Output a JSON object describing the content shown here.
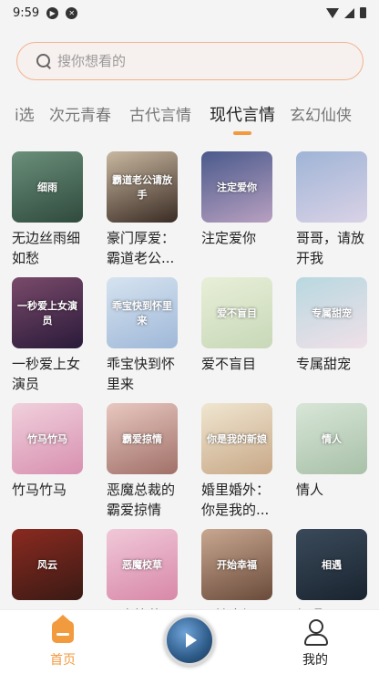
{
  "status": {
    "time": "9:59"
  },
  "search": {
    "placeholder": "搜你想看的"
  },
  "tabs": [
    "i选",
    "次元青春",
    "古代言情",
    "现代言情",
    "玄幻仙侠"
  ],
  "active_tab_index": 3,
  "colors": {
    "accent": "#f29a3e",
    "search_border": "#f2b38e"
  },
  "books": [
    {
      "title": "无边丝雨细如愁",
      "cover_text": "细雨",
      "colors": [
        "#6a8f7a",
        "#2f4a3d"
      ]
    },
    {
      "title": "豪门厚爱：霸道老公...",
      "cover_text": "霸道老公请放手",
      "colors": [
        "#c9b8a0",
        "#3a2b24"
      ]
    },
    {
      "title": "注定爱你",
      "cover_text": "注定爱你",
      "colors": [
        "#4a5a8c",
        "#b8a0c0"
      ]
    },
    {
      "title": "哥哥，请放开我",
      "cover_text": "",
      "colors": [
        "#9fb4d6",
        "#d9d2e6"
      ]
    },
    {
      "title": "一秒爱上女演员",
      "cover_text": "一秒爱上女演员",
      "colors": [
        "#7a4a6a",
        "#2a1a3a"
      ]
    },
    {
      "title": "乖宝快到怀里来",
      "cover_text": "乖宝快到怀里来",
      "colors": [
        "#d6e3f0",
        "#9fb8d8"
      ]
    },
    {
      "title": "爱不盲目",
      "cover_text": "爱不盲目",
      "colors": [
        "#e8efd8",
        "#c8d8b8"
      ]
    },
    {
      "title": "专属甜宠",
      "cover_text": "专属甜宠",
      "colors": [
        "#b8d8e0",
        "#f0e0e8"
      ]
    },
    {
      "title": "竹马竹马",
      "cover_text": "竹马竹马",
      "colors": [
        "#f0d0dc",
        "#d890b0"
      ]
    },
    {
      "title": "恶魔总裁的霸爱掠情",
      "cover_text": "霸爱掠情",
      "colors": [
        "#e8c8c0",
        "#a07068"
      ]
    },
    {
      "title": "婚里婚外：你是我的...",
      "cover_text": "你是我的新娘",
      "colors": [
        "#f0e6d0",
        "#c8a888"
      ]
    },
    {
      "title": "情人",
      "cover_text": "情人",
      "colors": [
        "#d8e6d8",
        "#a8c0a8"
      ]
    },
    {
      "title": "风云...",
      "cover_text": "风云",
      "colors": [
        "#8a2a20",
        "#3a1a14"
      ]
    },
    {
      "title": "恶魔校草...",
      "cover_text": "恶魔校草",
      "colors": [
        "#f0c8d8",
        "#d888a8"
      ]
    },
    {
      "title": "开始幸福...",
      "cover_text": "开始幸福",
      "colors": [
        "#c8a890",
        "#6a4a3a"
      ]
    },
    {
      "title": "相遇...",
      "cover_text": "相遇",
      "colors": [
        "#3a4a5a",
        "#1a2430"
      ]
    }
  ],
  "nav": {
    "home_label": "首页",
    "mine_label": "我的"
  }
}
